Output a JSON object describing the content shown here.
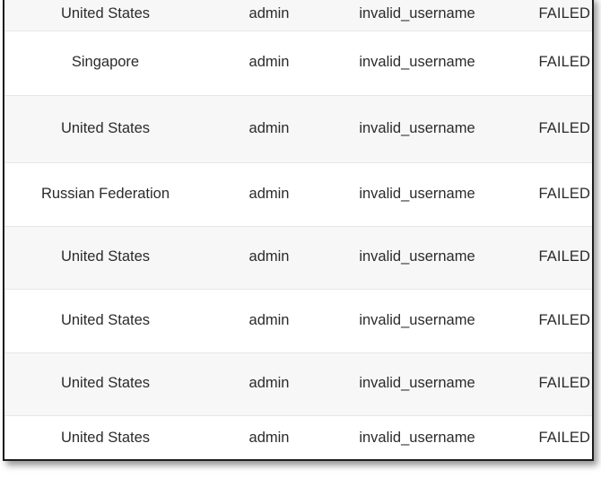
{
  "panel": {
    "type": "login-attempts-table",
    "accent_color": "#2b2b2b",
    "shaded_row_color": "#f7f7f7",
    "plain_row_color": "#ffffff",
    "divider_color": "#e6e6e6",
    "border_color": "#1c1c1c"
  },
  "table": {
    "icon_name": "edit-list-icon",
    "rows": [
      {
        "country": "United States",
        "username": "admin",
        "reason": "invalid_username",
        "status": "FAILED"
      },
      {
        "country": "Singapore",
        "username": "admin",
        "reason": "invalid_username",
        "status": "FAILED"
      },
      {
        "country": "United States",
        "username": "admin",
        "reason": "invalid_username",
        "status": "FAILED"
      },
      {
        "country": "Russian Federation",
        "username": "admin",
        "reason": "invalid_username",
        "status": "FAILED"
      },
      {
        "country": "United States",
        "username": "admin",
        "reason": "invalid_username",
        "status": "FAILED"
      },
      {
        "country": "United States",
        "username": "admin",
        "reason": "invalid_username",
        "status": "FAILED"
      },
      {
        "country": "United States",
        "username": "admin",
        "reason": "invalid_username",
        "status": "FAILED"
      },
      {
        "country": "United States",
        "username": "admin",
        "reason": "invalid_username",
        "status": "FAILED"
      }
    ]
  }
}
